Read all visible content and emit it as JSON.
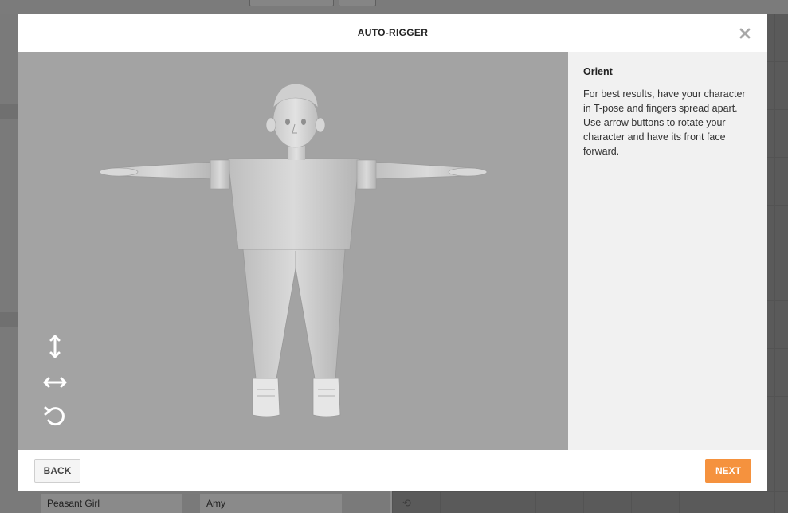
{
  "dialog": {
    "title": "AUTO-RIGGER",
    "close_icon": "close-icon"
  },
  "controls": {
    "rotate_vertical_icon": "vertical-arrows-icon",
    "rotate_horizontal_icon": "horizontal-arrows-icon",
    "reset_icon": "undo-rotate-icon"
  },
  "sidebar": {
    "heading": "Orient",
    "instructions": "For best results, have your character in T-pose and fingers spread apart. Use arrow buttons to rotate your character and have its front face forward."
  },
  "footer": {
    "back_label": "BACK",
    "next_label": "NEXT"
  },
  "background": {
    "cards": [
      "Peasant Girl",
      "Amy"
    ]
  },
  "colors": {
    "accent": "#f5923e",
    "viewport_bg": "#a3a3a3",
    "sidebar_bg": "#f1f1f1"
  }
}
